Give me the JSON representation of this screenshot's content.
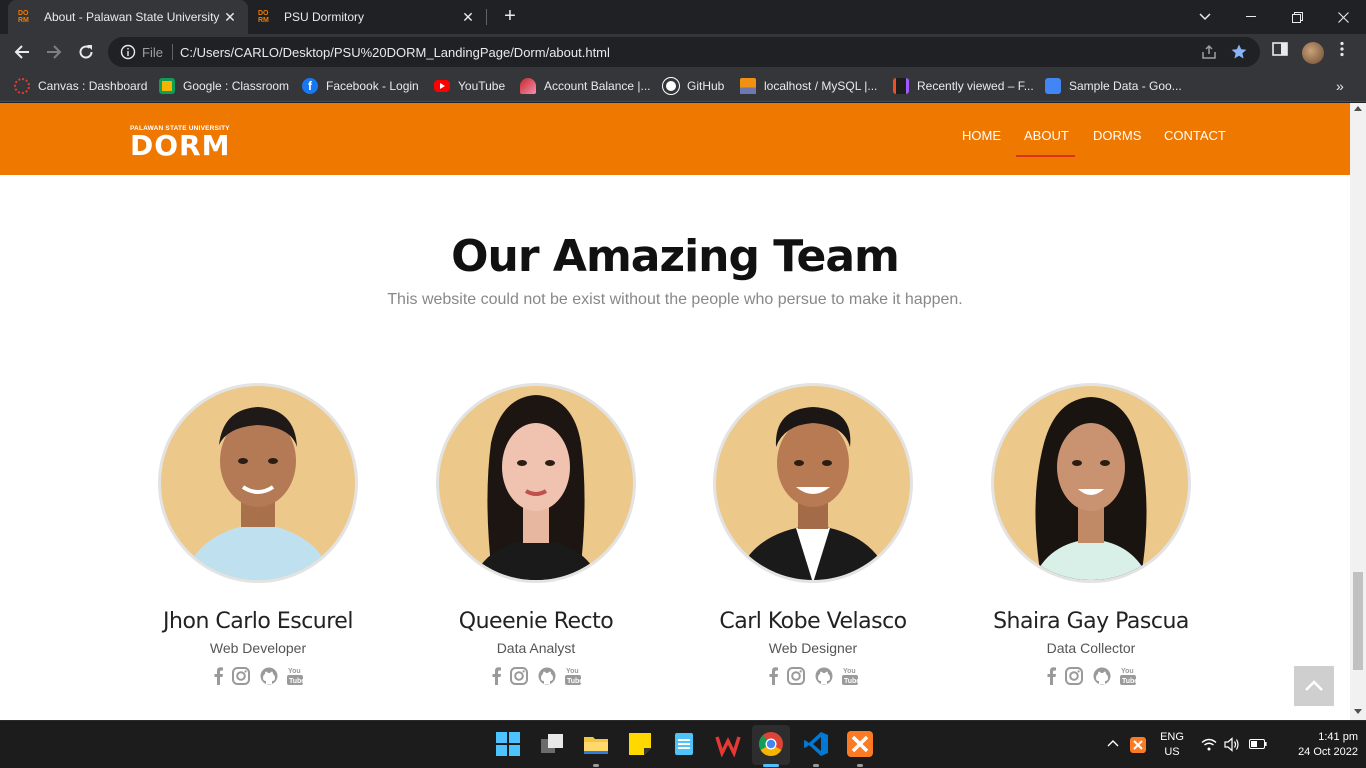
{
  "browser": {
    "tabs": [
      {
        "favicon_text_top": "DO",
        "favicon_text_bottom": "RM",
        "title": "About - Palawan State University",
        "active": true
      },
      {
        "favicon_text_top": "DO",
        "favicon_text_bottom": "RM",
        "title": "PSU Dormitory",
        "active": false
      }
    ],
    "new_tab_label": "+",
    "close_label": "✕",
    "address": {
      "scheme_label": "File",
      "url": "C:/Users/CARLO/Desktop/PSU%20DORM_LandingPage/Dorm/about.html"
    },
    "bookmarks": [
      {
        "label": "Canvas : Dashboard",
        "icon": "canvas-icon",
        "color": "#e13f2b"
      },
      {
        "label": "Google : Classroom",
        "icon": "classroom-icon",
        "color": "#f4b400"
      },
      {
        "label": "Facebook - Login",
        "icon": "facebook-icon",
        "color": "#1877f2"
      },
      {
        "label": "YouTube",
        "icon": "youtube-icon",
        "color": "#ff0000"
      },
      {
        "label": "Account Balance |...",
        "icon": "account-icon",
        "color": "#c62828"
      },
      {
        "label": "GitHub",
        "icon": "github-icon",
        "color": "#ffffff"
      },
      {
        "label": "localhost / MySQL |...",
        "icon": "phpmyadmin-icon",
        "color": "#f29111"
      },
      {
        "label": "Recently viewed – F...",
        "icon": "figma-icon",
        "color": "#a259ff"
      },
      {
        "label": "Sample Data - Goo...",
        "icon": "docs-icon",
        "color": "#4285f4"
      }
    ],
    "bookmarks_overflow": "»"
  },
  "site": {
    "accent_color": "#ef7800",
    "logo": {
      "small_text": "PALAWAN STATE UNIVERSITY",
      "big_text": "DORM"
    },
    "nav": [
      {
        "label": "HOME",
        "active": false
      },
      {
        "label": "ABOUT",
        "active": true
      },
      {
        "label": "DORMS",
        "active": false
      },
      {
        "label": "CONTACT",
        "active": false
      }
    ],
    "section_title": "Our Amazing Team",
    "section_subtitle": "This website could not be exist without the people who persue to make it happen.",
    "team": [
      {
        "name": "Jhon Carlo Escurel",
        "role": "Web Developer"
      },
      {
        "name": "Queenie Recto",
        "role": "Data Analyst"
      },
      {
        "name": "Carl Kobe Velasco",
        "role": "Web Designer"
      },
      {
        "name": "Shaira Gay Pascua",
        "role": "Data Collector"
      }
    ],
    "social_icons": [
      "facebook-icon",
      "instagram-icon",
      "github-icon",
      "youtube-icon"
    ],
    "back_to_top_icon": "chevron-up-icon"
  },
  "taskbar": {
    "apps": [
      "start-icon",
      "task-view-icon",
      "file-explorer-icon",
      "sticky-notes-icon",
      "notepad-icon",
      "wps-office-icon",
      "chrome-icon",
      "vscode-icon",
      "xampp-icon"
    ],
    "language_line1": "ENG",
    "language_line2": "US",
    "time": "1:41 pm",
    "date": "24 Oct 2022"
  }
}
